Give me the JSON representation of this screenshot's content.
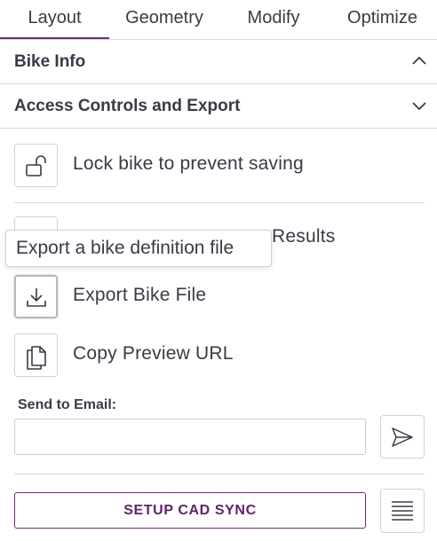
{
  "tabs": [
    {
      "label": "Layout",
      "active": true
    },
    {
      "label": "Geometry",
      "active": false
    },
    {
      "label": "Modify",
      "active": false
    },
    {
      "label": "Optimize",
      "active": false
    }
  ],
  "sections": {
    "bike_info": {
      "label": "Bike Info",
      "expanded": true
    },
    "access_controls": {
      "label": "Access Controls and Export",
      "expanded": false
    }
  },
  "actions": {
    "lock": {
      "label": "Lock bike to prevent saving",
      "icon": "unlocked-padlock-icon"
    },
    "results": {
      "label": "Results",
      "icon": "download-icon"
    },
    "export": {
      "label": "Export Bike File",
      "icon": "download-icon"
    },
    "copy": {
      "label": "Copy Preview URL",
      "icon": "copy-icon"
    }
  },
  "tooltip": {
    "text": "Export a bike definition file"
  },
  "email": {
    "label": "Send to Email:",
    "value": "",
    "placeholder": ""
  },
  "cad_sync": {
    "label": "SETUP CAD SYNC"
  },
  "colors": {
    "accent": "#6b2f77",
    "text": "#3a3a48",
    "border": "#d2d2d8"
  }
}
